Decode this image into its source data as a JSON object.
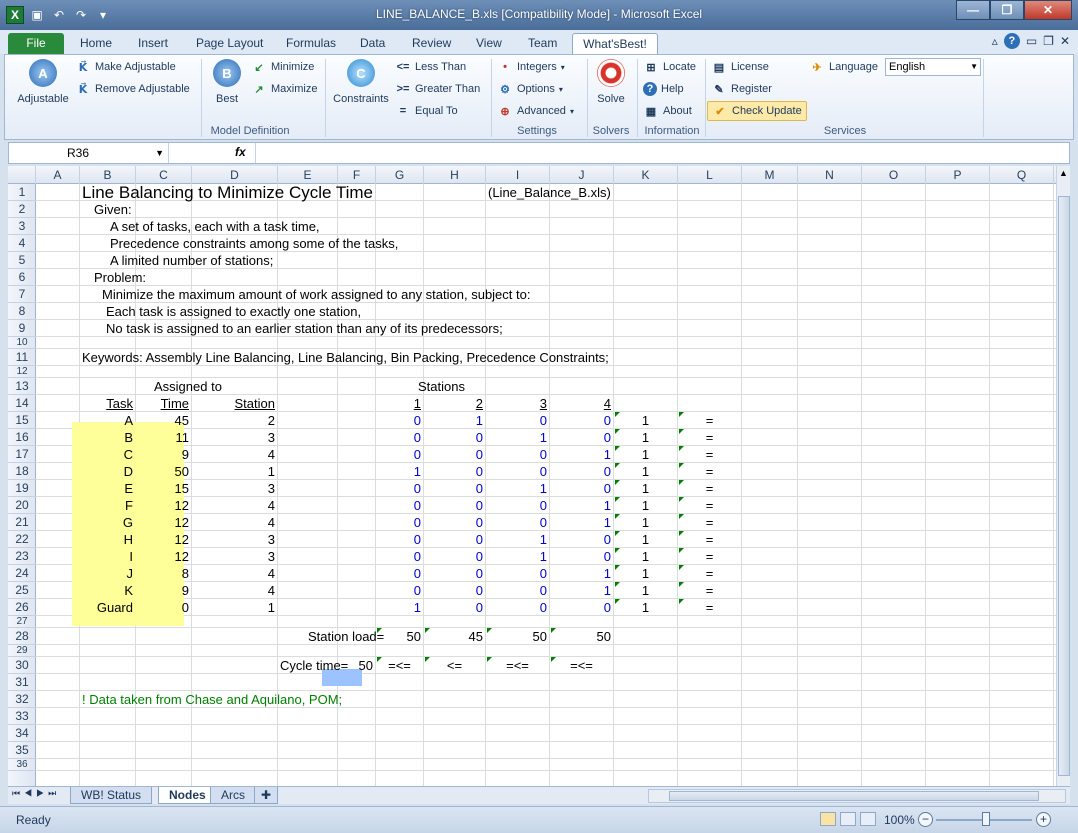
{
  "window": {
    "title": "LINE_BALANCE_B.xls  [Compatibility Mode]  -  Microsoft Excel"
  },
  "ribbon_tabs": [
    "File",
    "Home",
    "Insert",
    "Page Layout",
    "Formulas",
    "Data",
    "Review",
    "View",
    "Team",
    "What'sBest!"
  ],
  "ribbon": {
    "adjustable": "Adjustable",
    "make_adjustable": "Make Adjustable",
    "remove_adjustable": "Remove Adjustable",
    "best": "Best",
    "minimize": "Minimize",
    "maximize": "Maximize",
    "constraints": "Constraints",
    "less_than": "Less Than",
    "greater_than": "Greater Than",
    "equal_to": "Equal To",
    "integers": "Integers",
    "options": "Options",
    "advanced": "Advanced",
    "solve": "Solve",
    "locate": "Locate",
    "help": "Help",
    "about": "About",
    "license": "License",
    "register": "Register",
    "check_update": "Check Update",
    "language": "Language",
    "language_value": "English",
    "groups": {
      "model_definition": "Model Definition",
      "settings": "Settings",
      "solvers": "Solvers",
      "information": "Information",
      "services": "Services"
    },
    "icons": {
      "less": "<=",
      "greater": ">=",
      "equal": "="
    }
  },
  "formula_bar": {
    "name_box": "R36",
    "fx": "fx",
    "formula": ""
  },
  "grid": {
    "columns": [
      "A",
      "B",
      "C",
      "D",
      "E",
      "F",
      "G",
      "H",
      "I",
      "J",
      "K",
      "L",
      "M",
      "N",
      "O",
      "P",
      "Q"
    ],
    "rows": [
      "1",
      "2",
      "3",
      "4",
      "5",
      "6",
      "7",
      "8",
      "9",
      "10",
      "11",
      "12",
      "13",
      "14",
      "15",
      "16",
      "17",
      "18",
      "19",
      "20",
      "21",
      "22",
      "23",
      "24",
      "25",
      "26",
      "27",
      "28",
      "29",
      "30",
      "31",
      "32",
      "33",
      "34",
      "35",
      "36"
    ]
  },
  "sheet": {
    "title": "Line Balancing to Minimize Cycle Time",
    "filename": "(Line_Balance_B.xls)",
    "given": "Given:",
    "given_1": "A set of tasks, each with a task time,",
    "given_2": "Precedence constraints among some of the tasks,",
    "given_3": "A limited number of stations;",
    "problem": "Problem:",
    "problem_1": "Minimize the maximum amount of work assigned to any station, subject to:",
    "problem_2": "Each task  is assigned to exactly one station,",
    "problem_3": "No task is assigned to an earlier station than any of its predecessors;",
    "keywords": "Keywords: Assembly Line Balancing, Line Balancing, Bin Packing, Precedence Constraints;",
    "assigned_to": "Assigned to",
    "stations": "Stations",
    "hdr_task": "Task",
    "hdr_time": "Time",
    "hdr_station": "Station",
    "station_numbers": [
      "1",
      "2",
      "3",
      "4"
    ],
    "tasks": [
      {
        "task": "A",
        "time": "45",
        "station": "2",
        "x": [
          "0",
          "1",
          "0",
          "0"
        ],
        "sum": "1",
        "rel": "="
      },
      {
        "task": "B",
        "time": "11",
        "station": "3",
        "x": [
          "0",
          "0",
          "1",
          "0"
        ],
        "sum": "1",
        "rel": "="
      },
      {
        "task": "C",
        "time": "9",
        "station": "4",
        "x": [
          "0",
          "0",
          "0",
          "1"
        ],
        "sum": "1",
        "rel": "="
      },
      {
        "task": "D",
        "time": "50",
        "station": "1",
        "x": [
          "1",
          "0",
          "0",
          "0"
        ],
        "sum": "1",
        "rel": "="
      },
      {
        "task": "E",
        "time": "15",
        "station": "3",
        "x": [
          "0",
          "0",
          "1",
          "0"
        ],
        "sum": "1",
        "rel": "="
      },
      {
        "task": "F",
        "time": "12",
        "station": "4",
        "x": [
          "0",
          "0",
          "0",
          "1"
        ],
        "sum": "1",
        "rel": "="
      },
      {
        "task": "G",
        "time": "12",
        "station": "4",
        "x": [
          "0",
          "0",
          "0",
          "1"
        ],
        "sum": "1",
        "rel": "="
      },
      {
        "task": "H",
        "time": "12",
        "station": "3",
        "x": [
          "0",
          "0",
          "1",
          "0"
        ],
        "sum": "1",
        "rel": "="
      },
      {
        "task": "I",
        "time": "12",
        "station": "3",
        "x": [
          "0",
          "0",
          "1",
          "0"
        ],
        "sum": "1",
        "rel": "="
      },
      {
        "task": "J",
        "time": "8",
        "station": "4",
        "x": [
          "0",
          "0",
          "0",
          "1"
        ],
        "sum": "1",
        "rel": "="
      },
      {
        "task": "K",
        "time": "9",
        "station": "4",
        "x": [
          "0",
          "0",
          "0",
          "1"
        ],
        "sum": "1",
        "rel": "="
      },
      {
        "task": "Guard",
        "time": "0",
        "station": "1",
        "x": [
          "1",
          "0",
          "0",
          "0"
        ],
        "sum": "1",
        "rel": "="
      }
    ],
    "station_load_label": "Station load=",
    "station_loads": [
      "50",
      "45",
      "50",
      "50"
    ],
    "cycle_time_label": "Cycle time=",
    "cycle_time": "50",
    "cycle_rels": [
      "=<=",
      "<=",
      "=<=",
      "=<="
    ],
    "source_note": "! Data taken from Chase and Aquilano, POM;"
  },
  "sheet_tabs": [
    "WB! Status",
    "Nodes",
    "Arcs"
  ],
  "status": {
    "ready": "Ready",
    "zoom": "100%"
  }
}
